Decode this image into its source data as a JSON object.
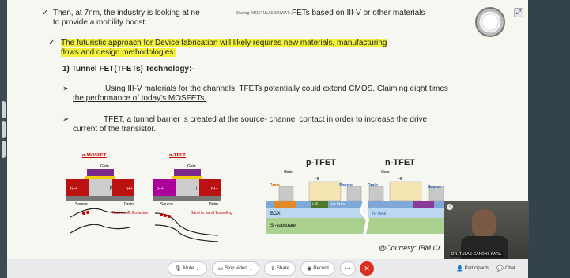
{
  "slide": {
    "bullet1_line1": "Then, at 7nm, the industry is looking at ne",
    "bullet1_overlay": "Sharing (MOSTULAS SAIWAT...",
    "bullet1_line1_end": "FETs based on III-V or other materials",
    "bullet1_line2": "to provide a mobility boost.",
    "bullet2_line1": "The futuristic approach for Device fabrication will likely  requires new materials, manufacturing",
    "bullet2_line2": "flows and design methodologies.",
    "heading": "1)  Tunnel FET(TFETs) Technology:-",
    "sub1_line1": "Using III-V materials for the channels, TFETs potentially could extend CMOS. Claiming eight times",
    "sub1_line2": "the performance of today's MOSFETs.",
    "sub2_line1": "TFET, a tunnel barrier is created at the source- channel contact in order to increase the drive",
    "sub2_line2": "current of the transistor.",
    "courtesy": "@Courtesy: IBM Cr"
  },
  "diagram": {
    "nmos_title": "n-MOSFET",
    "ntfet_title": "n-TFET",
    "gate": "Gate",
    "source": "Source",
    "drain": "Drain",
    "n_plus": "n++",
    "p_plus": "p++",
    "p_region": "P",
    "i_region": "i",
    "thermionic": "Thermionic Emission",
    "band_tunneling": "Band to band Tunneling",
    "ptfet_title": "p-TFET",
    "ntfet2_title": "n-TFET",
    "lg": "Lg",
    "i_si": "i-Si",
    "n_ingaas": "n+ InAs",
    "n_inas": "n+ InAs",
    "box": "BOX",
    "si_substrate": "Si-substrate"
  },
  "video": {
    "participant_name": "DR. TULAS GANDHI..KARA"
  },
  "toolbar": {
    "mute": "Mute",
    "stop_video": "Stop video",
    "share": "Share",
    "record": "Record",
    "participants": "Participants",
    "chat": "Chat"
  },
  "colors": {
    "highlight": "#f2f23a",
    "end_call": "#d93025",
    "slide_bg": "#f7f7f2"
  }
}
